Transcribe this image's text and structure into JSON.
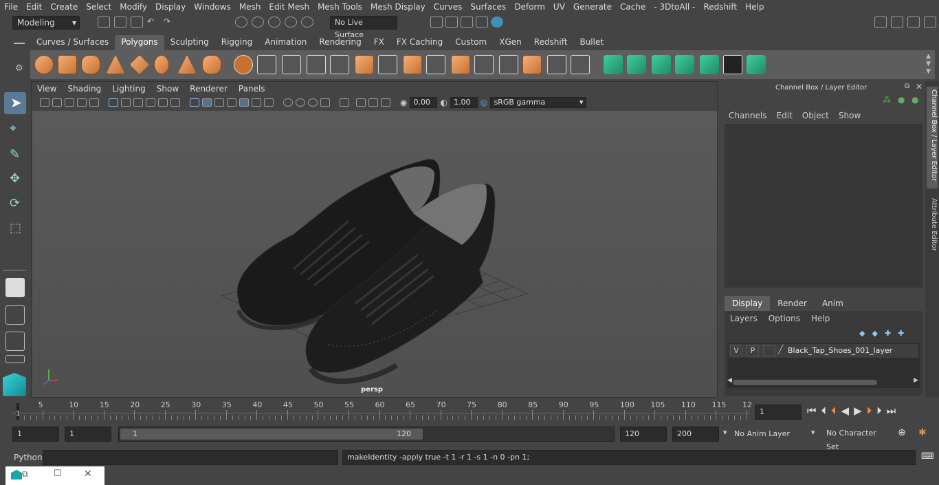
{
  "menubar": {
    "items": [
      "File",
      "Edit",
      "Create",
      "Select",
      "Modify",
      "Display",
      "Windows",
      "Mesh",
      "Edit Mesh",
      "Mesh Tools",
      "Mesh Display",
      "Curves",
      "Surfaces",
      "Deform",
      "UV",
      "Generate",
      "Cache",
      "- 3DtoAll -",
      "Redshift",
      "Help"
    ]
  },
  "status": {
    "mode": "Modeling",
    "live_surface": "No Live Surface"
  },
  "shelf": {
    "tabs": [
      "Curves / Surfaces",
      "Polygons",
      "Sculpting",
      "Rigging",
      "Animation",
      "Rendering",
      "FX",
      "FX Caching",
      "Custom",
      "XGen",
      "Redshift",
      "Bullet"
    ],
    "active_tab": "Polygons"
  },
  "viewport": {
    "menus": [
      "View",
      "Shading",
      "Lighting",
      "Show",
      "Renderer",
      "Panels"
    ],
    "exposure": "0.00",
    "gamma": "1.00",
    "color_space": "sRGB gamma",
    "camera_label": "persp"
  },
  "channel_box": {
    "title": "Channel Box / Layer Editor",
    "menus": [
      "Channels",
      "Edit",
      "Object",
      "Show"
    ],
    "layer_tabs": [
      "Display",
      "Render",
      "Anim"
    ],
    "active_layer_tab": "Display",
    "layer_menus": [
      "Layers",
      "Options",
      "Help"
    ],
    "layer": {
      "v": "V",
      "p": "P",
      "name": "Black_Tap_Shoes_001_layer"
    }
  },
  "side_tabs": [
    "Channel Box / Layer Editor",
    "Attribute Editor"
  ],
  "timeline": {
    "ticks": [
      "5",
      "10",
      "15",
      "20",
      "25",
      "30",
      "35",
      "40",
      "45",
      "50",
      "55",
      "60",
      "65",
      "70",
      "75",
      "80",
      "85",
      "90",
      "95",
      "100",
      "105",
      "110",
      "115",
      "12"
    ],
    "start_label": "1",
    "current_frame": "1"
  },
  "range": {
    "start": "1",
    "playback_start": "1",
    "slider_start": "1",
    "slider_end": "120",
    "end": "120",
    "anim_end": "200",
    "anim_layer": "No Anim Layer",
    "character_set": "No Character Set"
  },
  "command": {
    "language": "Python",
    "result": "makeIdentity -apply true -t 1 -r 1 -s 1 -n 0 -pn 1;"
  }
}
